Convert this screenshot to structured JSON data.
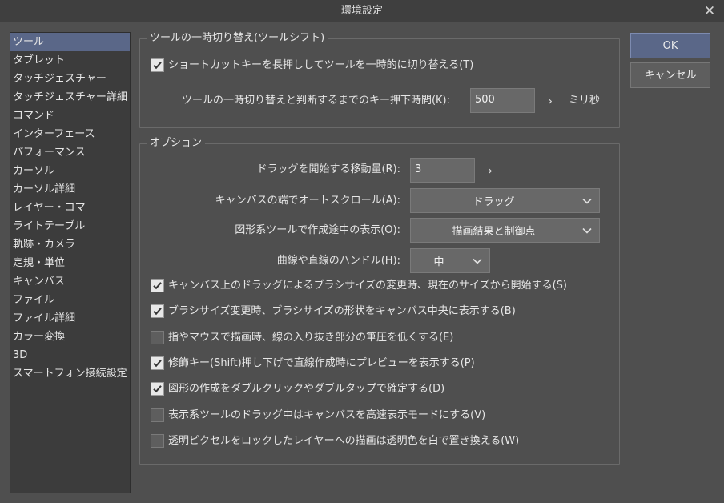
{
  "window": {
    "title": "環境設定"
  },
  "sidebar": {
    "items": [
      "ツール",
      "タブレット",
      "タッチジェスチャー",
      "タッチジェスチャー詳細",
      "コマンド",
      "インターフェース",
      "パフォーマンス",
      "カーソル",
      "カーソル詳細",
      "レイヤー・コマ",
      "ライトテーブル",
      "軌跡・カメラ",
      "定規・単位",
      "キャンバス",
      "ファイル",
      "ファイル詳細",
      "カラー変換",
      "3D",
      "スマートフォン接続設定"
    ],
    "selected_index": 0
  },
  "tool_shift": {
    "title": "ツールの一時切り替え(ツールシフト)",
    "checkbox_label": "ショートカットキーを長押ししてツールを一時的に切り替える(T)",
    "checked": true,
    "time_label": "ツールの一時切り替えと判断するまでのキー押下時間(K):",
    "time_value": "500",
    "time_unit": "ミリ秒"
  },
  "options": {
    "title": "オプション",
    "drag_label": "ドラッグを開始する移動量(R):",
    "drag_value": "3",
    "autoscroll_label": "キャンバスの端でオートスクロール(A):",
    "autoscroll_value": "ドラッグ",
    "shape_label": "図形系ツールで作成途中の表示(O):",
    "shape_value": "描画結果と制御点",
    "handle_label": "曲線や直線のハンドル(H):",
    "handle_value": "中",
    "checkboxes": [
      {
        "label": "キャンバス上のドラッグによるブラシサイズの変更時、現在のサイズから開始する(S)",
        "checked": true
      },
      {
        "label": "ブラシサイズ変更時、ブラシサイズの形状をキャンバス中央に表示する(B)",
        "checked": true
      },
      {
        "label": "指やマウスで描画時、線の入り抜き部分の筆圧を低くする(E)",
        "checked": false
      },
      {
        "label": "修飾キー(Shift)押し下げで直線作成時にプレビューを表示する(P)",
        "checked": true
      },
      {
        "label": "図形の作成をダブルクリックやダブルタップで確定する(D)",
        "checked": true
      },
      {
        "label": "表示系ツールのドラッグ中はキャンバスを高速表示モードにする(V)",
        "checked": false
      },
      {
        "label": "透明ピクセルをロックしたレイヤーへの描画は透明色を白で置き換える(W)",
        "checked": false
      }
    ]
  },
  "buttons": {
    "ok": "OK",
    "cancel": "キャンセル"
  },
  "icons": {
    "close": "close-icon",
    "check": "checkmark-icon",
    "chevron_right": "chevron-right-icon",
    "chevron_down": "chevron-down-icon"
  },
  "colors": {
    "accent": "#5a6788",
    "background": "#4f4f4f",
    "sidebar": "#3c3c3c"
  }
}
